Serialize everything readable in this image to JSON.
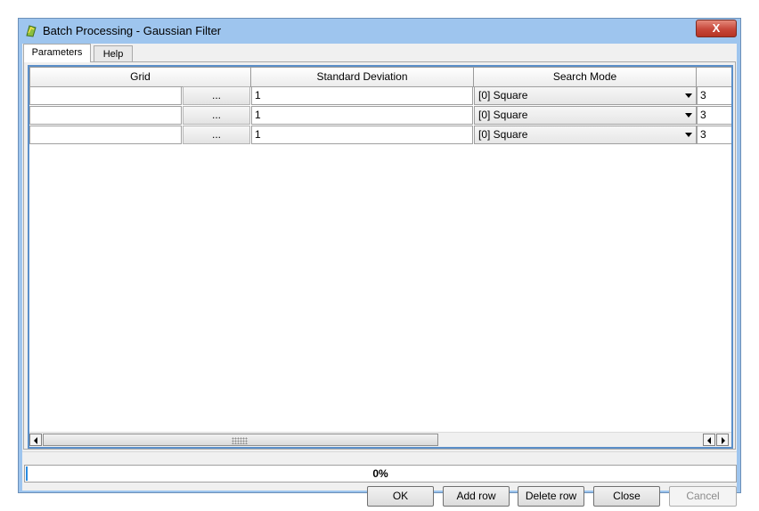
{
  "window": {
    "title": "Batch Processing - Gaussian Filter",
    "close_label": "X"
  },
  "tabs": [
    {
      "label": "Parameters"
    },
    {
      "label": "Help"
    }
  ],
  "table": {
    "columns": [
      "Grid",
      "Standard Deviation",
      "Search Mode"
    ],
    "browse_label": "...",
    "rows": [
      {
        "grid": "",
        "std_dev": "1",
        "search_mode": "[0] Square",
        "radius": "3"
      },
      {
        "grid": "",
        "std_dev": "1",
        "search_mode": "[0] Square",
        "radius": "3"
      },
      {
        "grid": "",
        "std_dev": "1",
        "search_mode": "[0] Square",
        "radius": "3"
      }
    ]
  },
  "progress": {
    "text": "0%",
    "value": 0
  },
  "buttons": {
    "ok": "OK",
    "add_row": "Add row",
    "delete_row": "Delete row",
    "close": "Close",
    "cancel": "Cancel"
  }
}
